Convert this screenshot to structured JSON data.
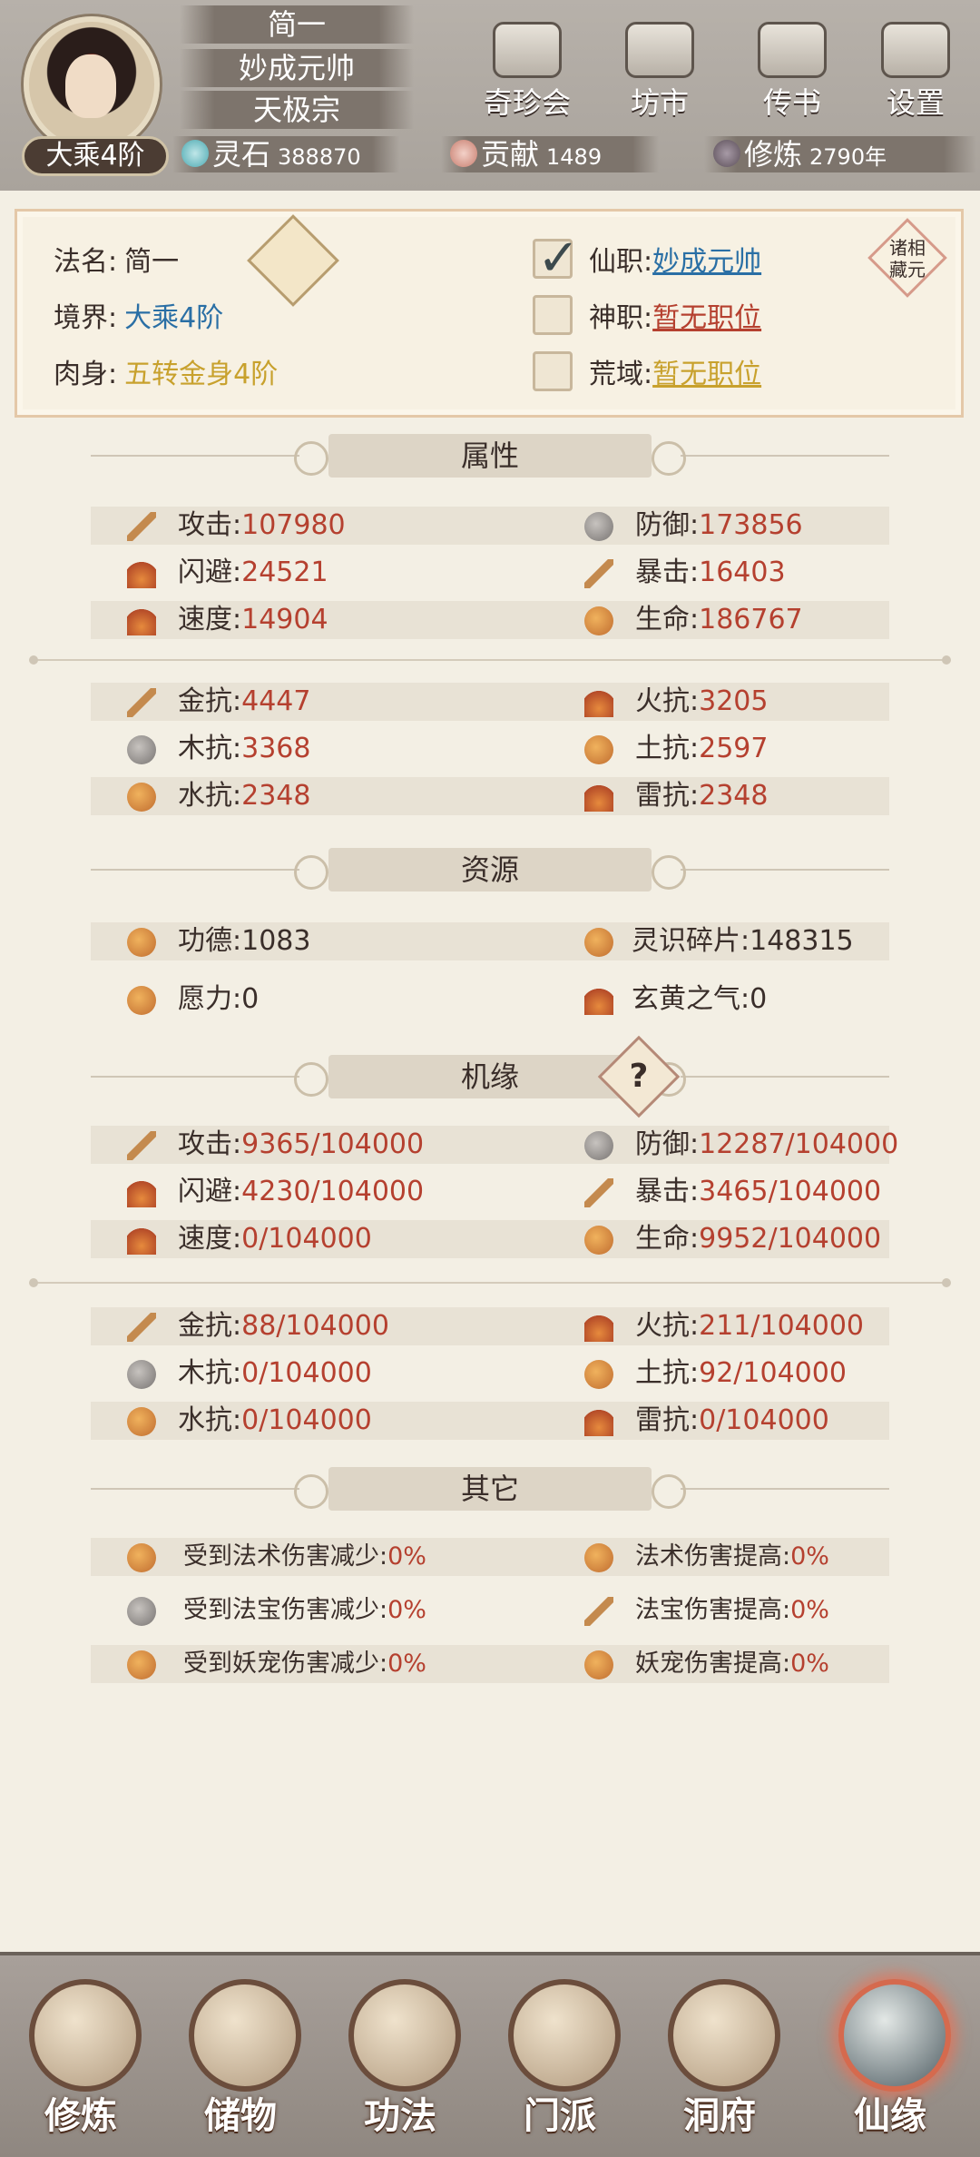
{
  "header": {
    "name": "简一",
    "title": "妙成元帅",
    "sect": "天极宗",
    "realm": "大乘4阶",
    "nav": [
      {
        "label": "奇珍会",
        "icon": "pavilion-icon"
      },
      {
        "label": "坊市",
        "icon": "market-icon"
      },
      {
        "label": "传书",
        "icon": "scroll-icon"
      },
      {
        "label": "设置",
        "icon": "gear-icon"
      }
    ],
    "resources": {
      "stone_label": "灵石",
      "stone_value": "388870",
      "contrib_label": "贡献",
      "contrib_value": "1489",
      "cultivate_label": "修炼",
      "cultivate_value": "2790年"
    }
  },
  "info": {
    "dharma_name_label": "法名:",
    "dharma_name": "简一",
    "realm_label": "境界:",
    "realm": "大乘4阶",
    "body_label": "肉身:",
    "body": "五转金身4阶",
    "immortal_label": "仙职:",
    "immortal": "妙成元帅",
    "divine_label": "神职:",
    "divine": "暂无职位",
    "wild_label": "荒域:",
    "wild": "暂无职位",
    "hidden_btn_line1": "诸相",
    "hidden_btn_line2": "藏元"
  },
  "sections": {
    "attributes": "属性",
    "resources": "资源",
    "fortune": "机缘",
    "other": "其它",
    "help_symbol": "?"
  },
  "attributes": {
    "attack": {
      "label": "攻击:",
      "value": "107980"
    },
    "defense": {
      "label": "防御:",
      "value": "173856"
    },
    "dodge": {
      "label": "闪避:",
      "value": "24521"
    },
    "crit": {
      "label": "暴击:",
      "value": "16403"
    },
    "speed": {
      "label": "速度:",
      "value": "14904"
    },
    "hp": {
      "label": "生命:",
      "value": "186767"
    },
    "metal": {
      "label": "金抗:",
      "value": "4447"
    },
    "fire": {
      "label": "火抗:",
      "value": "3205"
    },
    "wood": {
      "label": "木抗:",
      "value": "3368"
    },
    "earth": {
      "label": "土抗:",
      "value": "2597"
    },
    "water": {
      "label": "水抗:",
      "value": "2348"
    },
    "thunder": {
      "label": "雷抗:",
      "value": "2348"
    }
  },
  "resources_stats": {
    "merit": {
      "label": "功德:",
      "value": "1083"
    },
    "shards": {
      "label": "灵识碎片:",
      "value": "148315"
    },
    "wish": {
      "label": "愿力:",
      "value": "0"
    },
    "xuanhuang": {
      "label": "玄黄之气:",
      "value": "0"
    }
  },
  "fortune": {
    "attack": {
      "label": "攻击:",
      "value": "9365/104000"
    },
    "defense": {
      "label": "防御:",
      "value": "12287/104000"
    },
    "dodge": {
      "label": "闪避:",
      "value": "4230/104000"
    },
    "crit": {
      "label": "暴击:",
      "value": "3465/104000"
    },
    "speed": {
      "label": "速度:",
      "value": "0/104000"
    },
    "hp": {
      "label": "生命:",
      "value": "9952/104000"
    },
    "metal": {
      "label": "金抗:",
      "value": "88/104000"
    },
    "fire": {
      "label": "火抗:",
      "value": "211/104000"
    },
    "wood": {
      "label": "木抗:",
      "value": "0/104000"
    },
    "earth": {
      "label": "土抗:",
      "value": "92/104000"
    },
    "water": {
      "label": "水抗:",
      "value": "0/104000"
    },
    "thunder": {
      "label": "雷抗:",
      "value": "0/104000"
    }
  },
  "other": {
    "spell_dmg_reduce": {
      "label": "受到法术伤害减少:",
      "value": "0%"
    },
    "spell_dmg_up": {
      "label": "法术伤害提高:",
      "value": "0%"
    },
    "treasure_dmg_reduce": {
      "label": "受到法宝伤害减少:",
      "value": "0%"
    },
    "treasure_dmg_up": {
      "label": "法宝伤害提高:",
      "value": "0%"
    },
    "pet_dmg_reduce": {
      "label": "受到妖宠伤害减少:",
      "value": "0%"
    },
    "pet_dmg_up": {
      "label": "妖宠伤害提高:",
      "value": "0%"
    }
  },
  "bottom_nav": [
    {
      "label": "修炼",
      "icon": "cultivate-icon"
    },
    {
      "label": "储物",
      "icon": "storage-bag-icon"
    },
    {
      "label": "功法",
      "icon": "technique-book-icon"
    },
    {
      "label": "门派",
      "icon": "sect-gate-icon"
    },
    {
      "label": "洞府",
      "icon": "cave-icon"
    },
    {
      "label": "仙缘",
      "icon": "fortune-icon"
    }
  ],
  "colors": {
    "value_red": "#b5402f",
    "value_blue": "#2a6fa5",
    "value_gold": "#c8a12d",
    "background": "#f3efe4"
  }
}
